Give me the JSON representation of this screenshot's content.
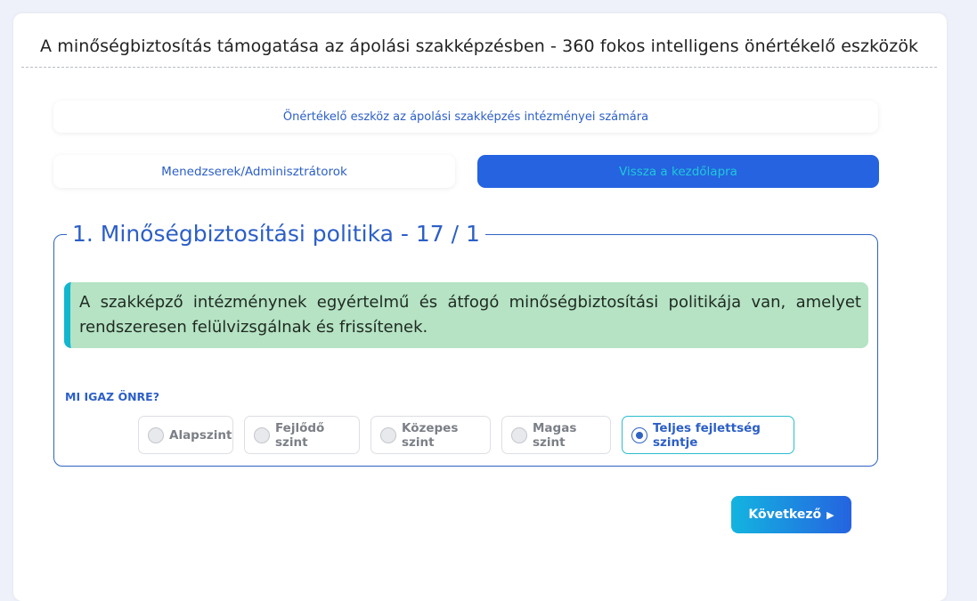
{
  "page": {
    "title": "A minőségbiztosítás támogatása az ápolási szakképzésben - 360 fokos intelligens önértékelő eszközök"
  },
  "header": {
    "subtitle": "Önértékelő eszköz az ápolási szakképzés intézményei számára"
  },
  "nav": {
    "role_label": "Menedzserek/Adminisztrátorok",
    "home_label": "Vissza a kezdőlapra"
  },
  "section": {
    "heading": "1. Minőségbiztosítási politika - 17 / 1",
    "statement": "A szakképző intézménynek egyértelmű és átfogó minőségbiztosítási politikája van, amelyet rendszeresen felülvizsgálnak és frissítenek.",
    "question": "MI IGAZ ÖNRE?",
    "options": [
      {
        "label": "Alapszint",
        "selected": false
      },
      {
        "label": "Fejlődő szint",
        "selected": false
      },
      {
        "label": "Közepes szint",
        "selected": false
      },
      {
        "label": "Magas szint",
        "selected": false
      },
      {
        "label": "Teljes fejlettség szintje",
        "selected": true
      }
    ]
  },
  "footer": {
    "next_label": "Következő",
    "next_icon": "play-arrow-icon"
  },
  "colors": {
    "accent": "#2563e0",
    "statement_bg": "#b5e3c4",
    "statement_border": "#13b6cf"
  }
}
